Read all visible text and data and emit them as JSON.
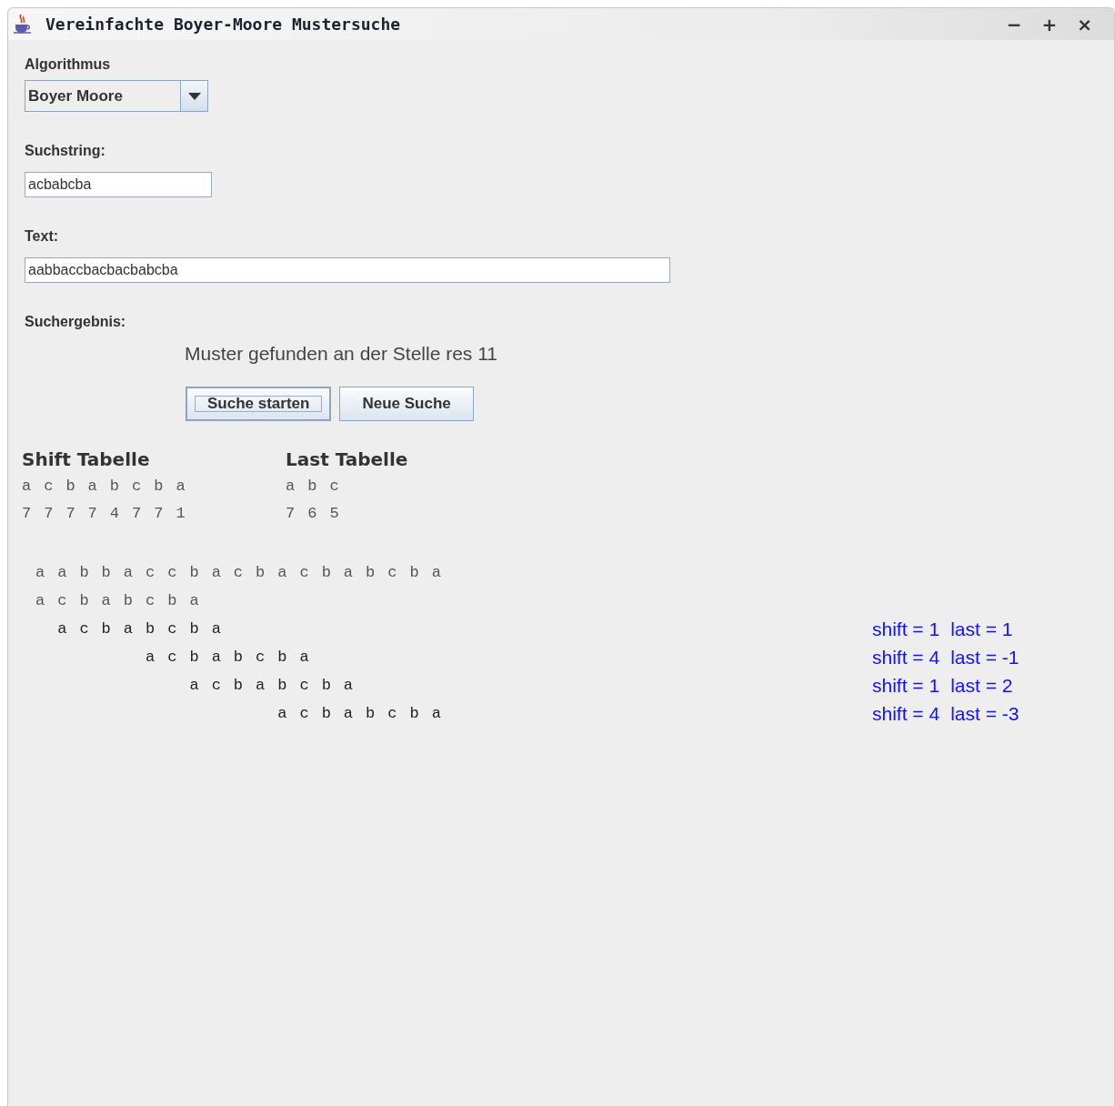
{
  "window": {
    "title": "Vereinfachte Boyer-Moore Mustersuche",
    "controls": [
      "−",
      "+",
      "×"
    ]
  },
  "algorithm": {
    "label": "Algorithmus",
    "value": "Boyer Moore"
  },
  "pattern": {
    "label": "Suchstring:",
    "value": "acbabcba"
  },
  "text": {
    "label": "Text:",
    "value": "aabbaccbacbacbabcba"
  },
  "result": {
    "label": "Suchergebnis:",
    "message": "Muster gefunden an der Stelle res 11"
  },
  "buttons": [
    {
      "label": "Suche starten",
      "focused": true
    },
    {
      "label": "Neue Suche",
      "focused": false
    }
  ],
  "shift_table": {
    "title": "Shift Tabelle",
    "chars": "a c b a b c b a",
    "values": "7 7 7 7 4 7 7 1"
  },
  "last_table": {
    "title": "Last Tabelle",
    "chars": "a b c",
    "values": "7 6 5"
  },
  "trace": [
    {
      "text": "a a b b a c c b a c b a c b a b c b a"
    },
    {
      "text": "a c b a b c b a"
    },
    {
      "text": "  a c b a b c b a",
      "shift": "shift = 1",
      "last": "last = 1"
    },
    {
      "text": "          a c b a b c b a",
      "shift": "shift = 4",
      "last": "last = -1"
    },
    {
      "text": "              a c b a b c b a",
      "shift": "shift = 1",
      "last": "last = 2"
    },
    {
      "text": "                      a c b a b c b a",
      "shift": "shift = 4",
      "last": "last = -3"
    }
  ]
}
